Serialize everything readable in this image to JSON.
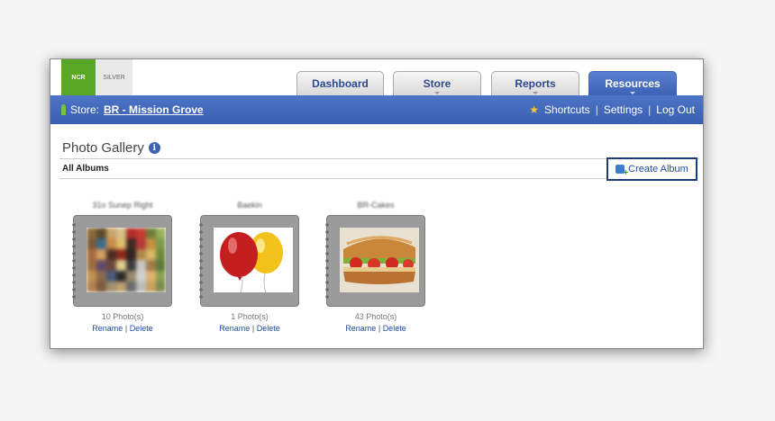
{
  "brand": {
    "logo": "NCR",
    "tier": "SILVER"
  },
  "tabs": [
    {
      "label": "Dashboard",
      "active": false
    },
    {
      "label": "Store",
      "active": false
    },
    {
      "label": "Reports",
      "active": false
    },
    {
      "label": "Resources",
      "active": true
    }
  ],
  "nav": {
    "store_prefix": "Store:",
    "store_name": "BR - Mission Grove",
    "shortcuts": "Shortcuts",
    "settings": "Settings",
    "logout": "Log Out"
  },
  "page": {
    "title": "Photo Gallery",
    "subtitle": "All Albums",
    "create_album": "Create Album"
  },
  "albums": [
    {
      "title": "31o Sunep Right",
      "count": "10 Photo(s)",
      "rename": "Rename",
      "delete": "Delete",
      "image": "blurred-photo-collage"
    },
    {
      "title": "Baekin",
      "count": "1 Photo(s)",
      "rename": "Rename",
      "delete": "Delete",
      "image": "balloons"
    },
    {
      "title": "BR-Cakes",
      "count": "43 Photo(s)",
      "rename": "Rename",
      "delete": "Delete",
      "image": "sandwich"
    }
  ],
  "colors": {
    "nav_blue": "#3d62b3",
    "accent_green": "#5aa626",
    "link_blue": "#1f4fa3"
  }
}
